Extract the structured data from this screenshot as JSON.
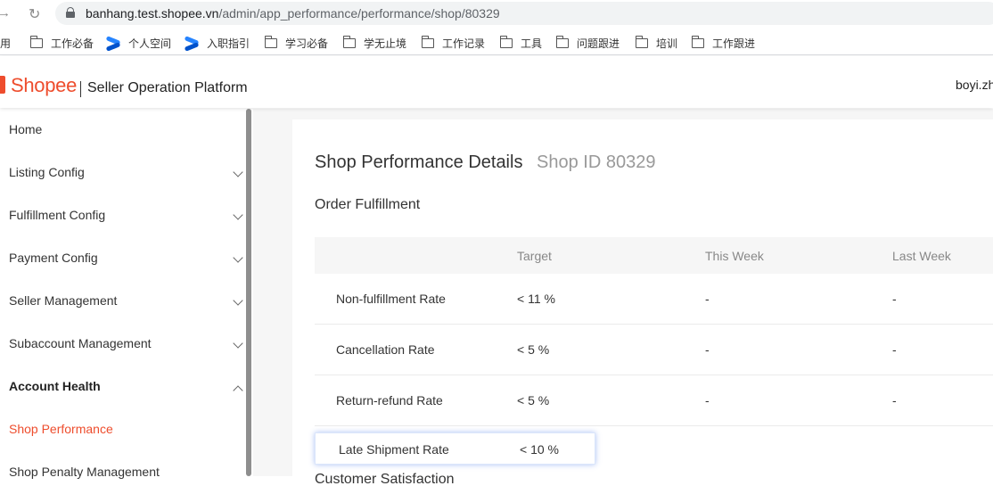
{
  "browser": {
    "url_host": "banhang.test.shopee.vn",
    "url_path": "/admin/app_performance/performance/shop/80329",
    "bookmarks": [
      {
        "label": "应用",
        "icon": "none"
      },
      {
        "label": "工作必备",
        "icon": "folder-icon"
      },
      {
        "label": "个人空间",
        "icon": "confluence-icon"
      },
      {
        "label": "入职指引",
        "icon": "confluence-icon"
      },
      {
        "label": "学习必备",
        "icon": "folder-icon"
      },
      {
        "label": "学无止境",
        "icon": "folder-icon"
      },
      {
        "label": "工作记录",
        "icon": "folder-icon"
      },
      {
        "label": "工具",
        "icon": "folder-icon"
      },
      {
        "label": "问题跟进",
        "icon": "folder-icon"
      },
      {
        "label": "培训",
        "icon": "folder-icon"
      },
      {
        "label": "工作跟进",
        "icon": "folder-icon"
      }
    ]
  },
  "header": {
    "logo": "Shopee",
    "platform_name": "Seller Operation Platform",
    "user": "boyi.zh"
  },
  "sidebar": {
    "items": [
      {
        "label": "Home",
        "chevron": "none"
      },
      {
        "label": "Listing Config",
        "chevron": "down"
      },
      {
        "label": "Fulfillment Config",
        "chevron": "down"
      },
      {
        "label": "Payment Config",
        "chevron": "down"
      },
      {
        "label": "Seller Management",
        "chevron": "down"
      },
      {
        "label": "Subaccount Management",
        "chevron": "down"
      },
      {
        "label": "Account Health",
        "chevron": "up",
        "expanded": true
      },
      {
        "label": "Shop Performance",
        "chevron": "none",
        "active": true
      },
      {
        "label": "Shop Penalty Management",
        "chevron": "none"
      }
    ]
  },
  "main": {
    "title": "Shop Performance Details",
    "shop_id": "Shop ID 80329",
    "section": "Order Fulfillment",
    "columns": [
      "Target",
      "This Week",
      "Last Week"
    ],
    "rows": [
      {
        "metric": "Non-fulfillment Rate",
        "target": "< 11 %",
        "this_week": "-",
        "last_week": "-"
      },
      {
        "metric": "Cancellation Rate",
        "target": "< 5 %",
        "this_week": "-",
        "last_week": "-"
      },
      {
        "metric": "Return-refund Rate",
        "target": "< 5 %",
        "this_week": "-",
        "last_week": "-"
      },
      {
        "metric": "Late Shipment Rate",
        "target": "< 10 %"
      }
    ],
    "next_section": "Customer Satisfaction"
  },
  "colors": {
    "brand": "#ee4d2d",
    "active_menu": "#ee4d2d",
    "table_header_bg": "#f6f6f6",
    "focus_glow": "#4678e6"
  }
}
